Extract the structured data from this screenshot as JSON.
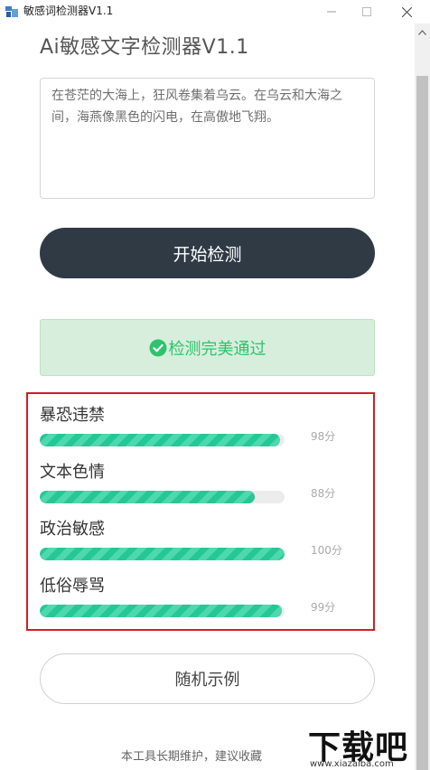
{
  "window": {
    "title": "敏感词检测器V1.1",
    "icon": "app-icon"
  },
  "header": {
    "title": "Ai敏感文字检测器V1.1"
  },
  "input": {
    "value": "在苍茫的大海上，狂风卷集着乌云。在乌云和大海之间，海燕像黑色的闪电，在高傲地飞翔。"
  },
  "actions": {
    "start_label": "开始检测",
    "random_label": "随机示例"
  },
  "result": {
    "message": "检测完美通过",
    "icon": "check-circle-icon",
    "color": "#2dc46c"
  },
  "categories": [
    {
      "label": "暴恐违禁",
      "score": 98,
      "score_text": "98分"
    },
    {
      "label": "文本色情",
      "score": 88,
      "score_text": "88分"
    },
    {
      "label": "政治敏感",
      "score": 100,
      "score_text": "100分"
    },
    {
      "label": "低俗辱骂",
      "score": 99,
      "score_text": "99分"
    }
  ],
  "footer": {
    "text": "本工具长期维护，建议收藏"
  },
  "watermark": {
    "logo_text": "下载吧",
    "url": "www.xiazaiba.com"
  },
  "colors": {
    "primary_button": "#2f3a45",
    "success": "#2dc46c",
    "bar_fill": "#26c796",
    "highlight": "#d21e24"
  }
}
